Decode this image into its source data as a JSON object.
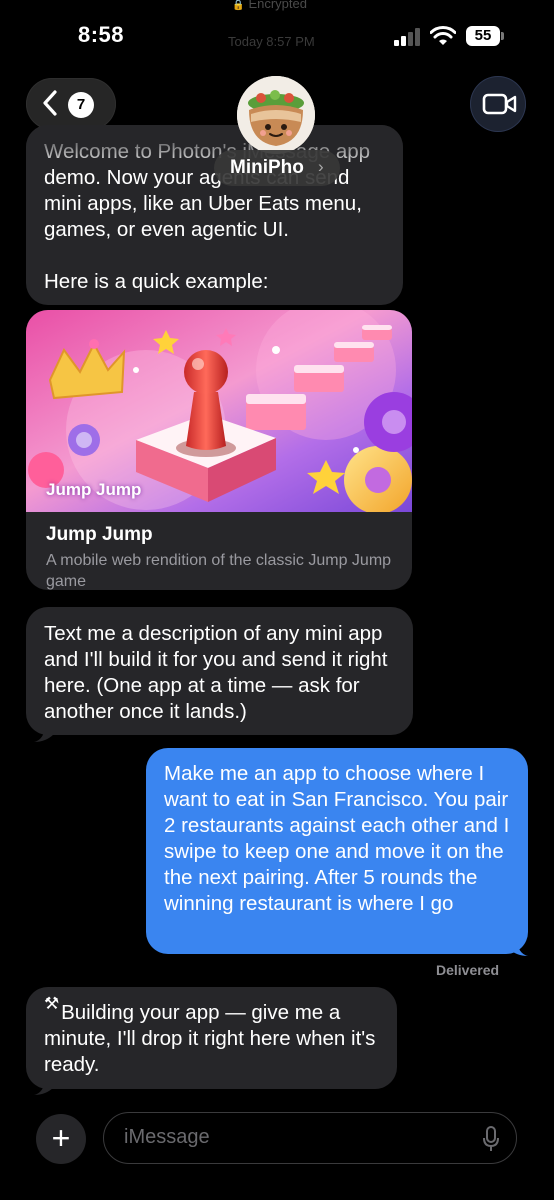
{
  "status_bar": {
    "time": "8:58",
    "encrypted_label": "Encrypted",
    "battery": "55"
  },
  "header": {
    "timestamp": "Today 8:57 PM",
    "back_badge_count": "7",
    "contact_name": "MiniPho",
    "contact_chevron": "›"
  },
  "messages": {
    "intro": "Welcome to Photon's iMessage app demo. Now your agents can send mini apps, like an Uber Eats menu, games, or even agentic UI.\n\nHere is a quick example:",
    "card": {
      "image_label": "Jump Jump",
      "title": "Jump Jump",
      "description": "A mobile web rendition of the classic Jump Jump game"
    },
    "instructions": "Text me a description of any mini app and I'll build it for you and send it right here. (One app at a time — ask for another once it lands.)",
    "user_request": "Make me an app to choose where I want to eat in San Francisco. You pair 2 restaurants against each other and I swipe to keep one and move it on the the next pairing. After 5 rounds the winning restaurant is where I go",
    "delivered_label": "Delivered",
    "building": "   Building your app — give me a minute, I'll drop it right here when it's ready."
  },
  "composer": {
    "plus_label": "+",
    "placeholder": "iMessage"
  },
  "colors": {
    "outgoing_bubble": "#3a85f0",
    "incoming_bubble": "#262629",
    "background": "#000000"
  },
  "icons": [
    "back-chevron-icon",
    "video-camera-icon",
    "lock-icon",
    "hammer-icon",
    "plus-icon",
    "microphone-icon",
    "signal-icon",
    "wifi-icon",
    "battery-icon"
  ]
}
